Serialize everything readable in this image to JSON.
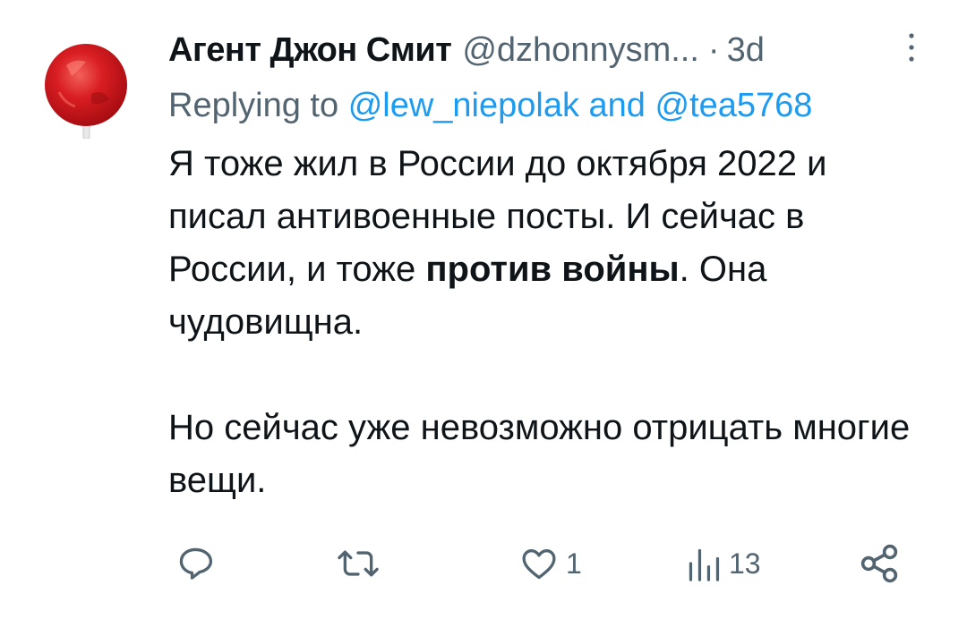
{
  "tweet": {
    "display_name": "Агент Джон Смит",
    "handle": "@dzhonnysm...",
    "dot": "·",
    "time": "3d",
    "reply": {
      "prefix": "Replying to",
      "mention1": "@lew_niepolak",
      "conj": "and",
      "mention2": "@tea5768"
    },
    "body": {
      "p1_part1": "Я тоже жил в России до октября 2022 и писал антивоенные посты. И сейчас в России, и тоже",
      "p1_bold": "против войны",
      "p1_part2": ". Она чудовищна.",
      "p2": "Но сейчас уже невозможно отрицать многие вещи."
    },
    "actions": {
      "reply_icon": "reply-icon",
      "retweet_icon": "retweet-icon",
      "like_icon": "heart-icon",
      "like_count": "1",
      "views_icon": "views-icon",
      "views_count": "13",
      "share_icon": "share-icon"
    }
  },
  "colors": {
    "text": "#0f1419",
    "secondary": "#536471",
    "link": "#1d9bf0",
    "avatar_red": "#d4161b"
  }
}
